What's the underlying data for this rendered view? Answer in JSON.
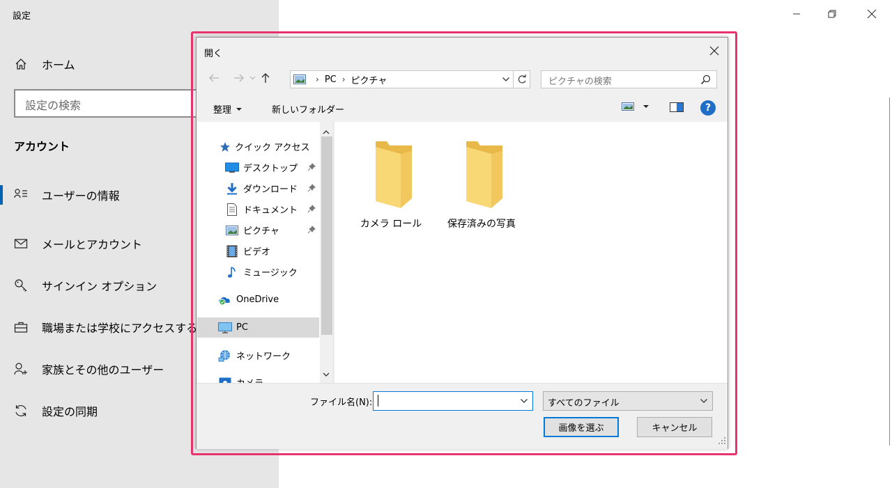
{
  "settings": {
    "title": "設定",
    "home": "ホーム",
    "search_placeholder": "設定の検索",
    "section": "アカウント",
    "nav": [
      "ユーザーの情報",
      "メールとアカウント",
      "サインイン オプション",
      "職場または学校にアクセスする",
      "家族とその他のユーザー",
      "設定の同期"
    ],
    "active_index": 0,
    "icons": [
      "home-icon",
      "user-info-icon",
      "mail-icon",
      "key-icon",
      "briefcase-icon",
      "add-user-icon",
      "sync-icon"
    ]
  },
  "dialog": {
    "title": "開く",
    "breadcrumb": [
      "PC",
      "ピクチャ"
    ],
    "search_placeholder": "ピクチャの検索",
    "toolbar": {
      "organize": "整理",
      "new_folder": "新しいフォルダー",
      "help": "?"
    },
    "nav_pane": {
      "quick_access": "クイック アクセス",
      "items": [
        "デスクトップ",
        "ダウンロード",
        "ドキュメント",
        "ピクチャ",
        "ビデオ",
        "ミュージック"
      ],
      "onedrive": "OneDrive",
      "pc": "PC",
      "network": "ネットワーク",
      "partial": "カメラ"
    },
    "folders": [
      "カメラ ロール",
      "保存済みの写真"
    ],
    "filename_label": "ファイル名(N):",
    "filename_value": "",
    "filter": "すべてのファイル",
    "buttons": {
      "open": "画像を選ぶ",
      "cancel": "キャンセル"
    }
  },
  "colors": {
    "accent": "#0078d7",
    "highlight": "#e8336d",
    "folder": "#f8d775"
  }
}
